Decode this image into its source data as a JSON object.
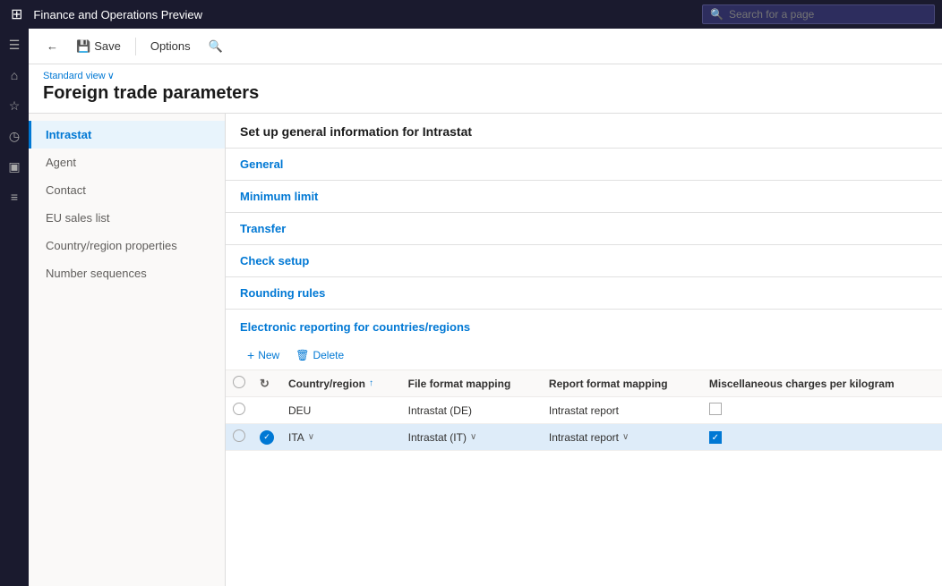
{
  "app": {
    "title": "Finance and Operations Preview",
    "search_placeholder": "Search for a page"
  },
  "toolbar": {
    "back_label": "",
    "save_label": "Save",
    "options_label": "Options",
    "search_label": ""
  },
  "page": {
    "view_label": "Standard view",
    "title": "Foreign trade parameters"
  },
  "side_nav": {
    "items": [
      {
        "id": "intrastat",
        "label": "Intrastat",
        "active": true
      },
      {
        "id": "agent",
        "label": "Agent",
        "active": false
      },
      {
        "id": "contact",
        "label": "Contact",
        "active": false
      },
      {
        "id": "eu-sales-list",
        "label": "EU sales list",
        "active": false
      },
      {
        "id": "country-region",
        "label": "Country/region properties",
        "active": false
      },
      {
        "id": "number-sequences",
        "label": "Number sequences",
        "active": false
      }
    ]
  },
  "form": {
    "section_title": "Set up general information for Intrastat",
    "sections": [
      {
        "id": "general",
        "label": "General"
      },
      {
        "id": "minimum-limit",
        "label": "Minimum limit"
      },
      {
        "id": "transfer",
        "label": "Transfer"
      },
      {
        "id": "check-setup",
        "label": "Check setup"
      },
      {
        "id": "rounding-rules",
        "label": "Rounding rules"
      }
    ],
    "electronic_reporting": {
      "title": "Electronic reporting for countries/regions",
      "new_label": "New",
      "delete_label": "Delete",
      "table": {
        "columns": [
          {
            "id": "country-region",
            "label": "Country/region",
            "sortable": true
          },
          {
            "id": "file-format",
            "label": "File format mapping"
          },
          {
            "id": "report-format",
            "label": "Report format mapping"
          },
          {
            "id": "misc-charges",
            "label": "Miscellaneous charges per kilogram"
          }
        ],
        "rows": [
          {
            "id": "deu",
            "selected": false,
            "country": "DEU",
            "file_format": "Intrastat (DE)",
            "report_format": "Intrastat report",
            "misc_checked": false
          },
          {
            "id": "ita",
            "selected": true,
            "country": "ITA",
            "file_format": "Intrastat (IT)",
            "report_format": "Intrastat report",
            "misc_checked": true
          }
        ]
      }
    }
  },
  "icons": {
    "grid": "⊞",
    "home": "⌂",
    "star": "☆",
    "clock": "○",
    "document": "▣",
    "list": "≡",
    "back_arrow": "←",
    "save": "💾",
    "search": "🔍",
    "chevron_down": "∨",
    "plus": "+",
    "trash": "🗑",
    "sort_up": "↑",
    "refresh": "↻"
  }
}
